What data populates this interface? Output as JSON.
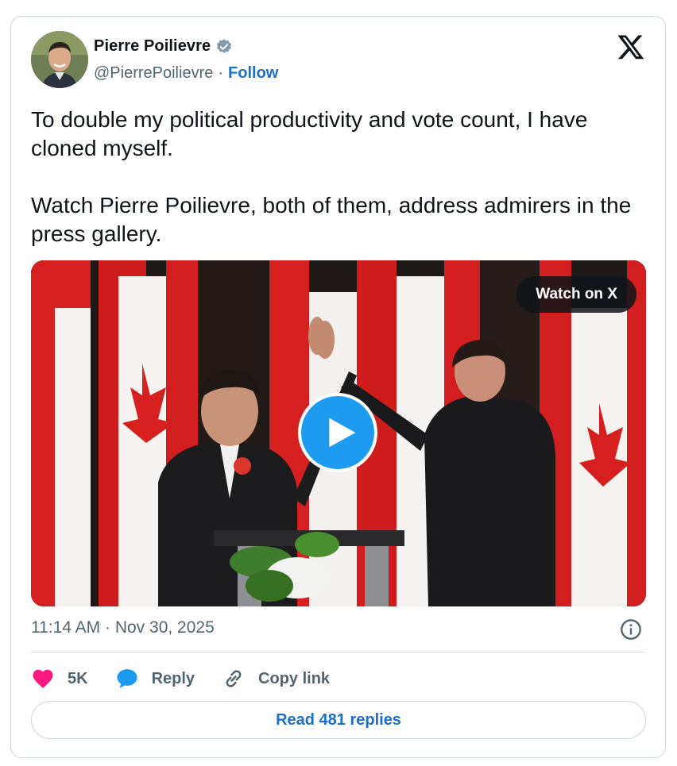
{
  "author": {
    "display_name": "Pierre Poilievre",
    "handle": "@PierrePoilievre",
    "separator": "·",
    "follow_label": "Follow",
    "verified_color": "#829aab"
  },
  "tweet": {
    "text": "To double my political productivity and vote count, I have cloned myself.\n\nWatch Pierre Poilievre, both of them, address admirers in the press gallery.",
    "timestamp": "11:14 AM · Nov 30, 2025"
  },
  "media": {
    "watch_label": "Watch on X",
    "play_color": "#1d9bf0"
  },
  "actions": {
    "like_count": "5K",
    "like_color": "#f91880",
    "reply_label": "Reply",
    "reply_color": "#1d9bf0",
    "copy_link_label": "Copy link"
  },
  "read_replies_label": "Read 481 replies",
  "icons": {
    "brand": "x-logo-icon",
    "verified": "verified-badge-icon",
    "info": "info-icon",
    "like": "heart-icon",
    "reply": "speech-bubble-icon",
    "copy": "link-icon",
    "play": "play-icon"
  }
}
